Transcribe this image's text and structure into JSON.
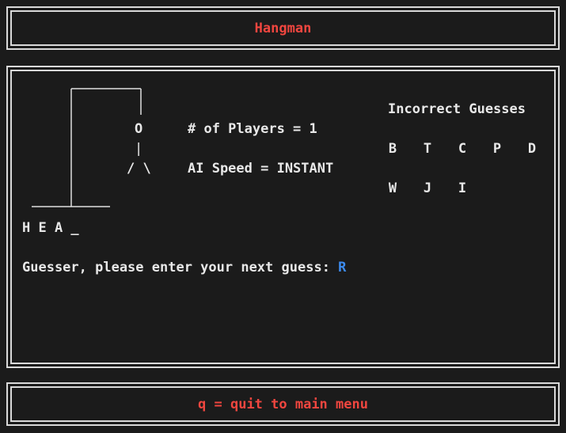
{
  "header": {
    "title": "Hangman"
  },
  "hangman": {
    "head": "O",
    "body_line": "|",
    "legs": "/ \\"
  },
  "game": {
    "players_label": "# of Players = 1",
    "ai_speed_label": "AI Speed = INSTANT",
    "word_display": "H E A _",
    "prompt": "Guesser, please enter your next guess: ",
    "current_input": "R"
  },
  "incorrect_guesses": {
    "title": "Incorrect Guesses",
    "letters": [
      "B",
      "T",
      "C",
      "P",
      "D",
      "W",
      "J",
      "I"
    ]
  },
  "footer": {
    "hint": "q = quit to main menu"
  },
  "colors": {
    "accent_red": "#f0463f",
    "input_blue": "#3d8cf0",
    "background": "#1b1b1b",
    "text": "#e8e8e8"
  }
}
